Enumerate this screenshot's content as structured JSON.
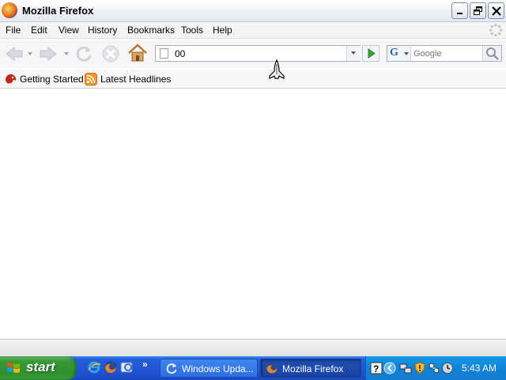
{
  "window": {
    "title": "Mozilla Firefox"
  },
  "menubar": {
    "items": [
      {
        "label": "File"
      },
      {
        "label": "Edit"
      },
      {
        "label": "View"
      },
      {
        "label": "History"
      },
      {
        "label": "Bookmarks"
      },
      {
        "label": "Tools"
      },
      {
        "label": "Help"
      }
    ]
  },
  "navbar": {
    "url_value": "00",
    "search_placeholder": "Google",
    "search_engine_letter": "G"
  },
  "bookmarks": {
    "items": [
      {
        "label": "Getting Started",
        "icon": "firefox-bookmark-icon"
      },
      {
        "label": "Latest Headlines",
        "icon": "rss-feed-icon"
      }
    ]
  },
  "taskbar": {
    "start_label": "start",
    "quick_launch": [
      "internet-explorer-icon",
      "firefox-icon",
      "outlook-express-icon"
    ],
    "more": "»",
    "tasks": [
      {
        "label": "Windows Upda...",
        "icon": "windows-update-icon"
      },
      {
        "label": "Mozilla Firefox",
        "icon": "firefox-icon",
        "active": true
      }
    ],
    "clock": "5:43 AM"
  },
  "colors": {
    "taskbar_blue": "#245edb",
    "start_green": "#3a9a3a",
    "tray_blue": "#0f83d8",
    "go_green": "#3aa33a"
  }
}
